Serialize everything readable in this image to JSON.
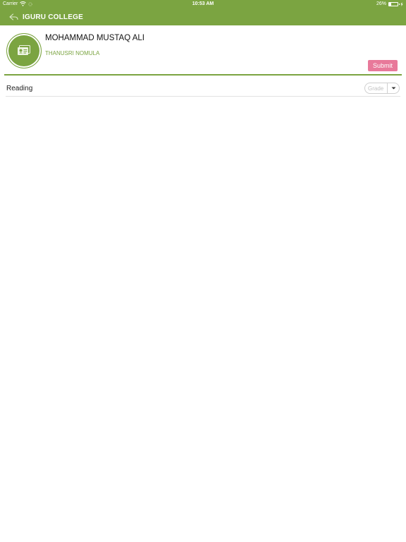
{
  "status_bar": {
    "carrier": "Carrier",
    "time": "10:53 AM",
    "battery_text": "26%",
    "battery_level": 0.26
  },
  "nav": {
    "title": "IGURU COLLEGE"
  },
  "student": {
    "name": "MOHAMMAD MUSTAQ ALI",
    "teacher": "THANUSRI NOMULA"
  },
  "actions": {
    "submit_label": "Submit"
  },
  "rows": [
    {
      "label": "Reading",
      "grade_placeholder": "Grade"
    }
  ],
  "colors": {
    "accent": "#7ba441",
    "submit": "#e8799a"
  },
  "icons": {
    "back": "back-arrow-icon",
    "avatar": "id-card-icon",
    "dropdown": "chevron-down-icon"
  }
}
